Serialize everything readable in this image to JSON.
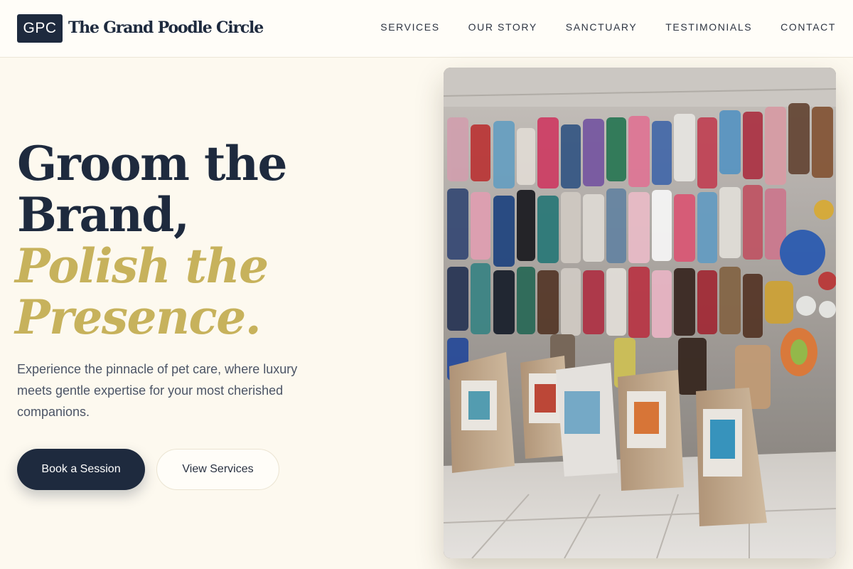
{
  "header": {
    "logo_text": "GPC",
    "brand_name": "The Grand Poodle Circle",
    "nav": [
      "SERVICES",
      "OUR STORY",
      "SANCTUARY",
      "TESTIMONIALS",
      "CONTACT"
    ]
  },
  "hero": {
    "headline_line1": "Groom the",
    "headline_line2": "Brand,",
    "accent_line1": "Polish the",
    "accent_line2": "Presence.",
    "subtext": "Experience the pinnacle of pet care, where luxury meets gentle expertise for your most cherished companions.",
    "primary_button": "Book a Session",
    "secondary_button": "View Services"
  },
  "colors": {
    "navy": "#1e2a3e",
    "gold": "#c7b25c",
    "cream": "#fdf9ef"
  }
}
